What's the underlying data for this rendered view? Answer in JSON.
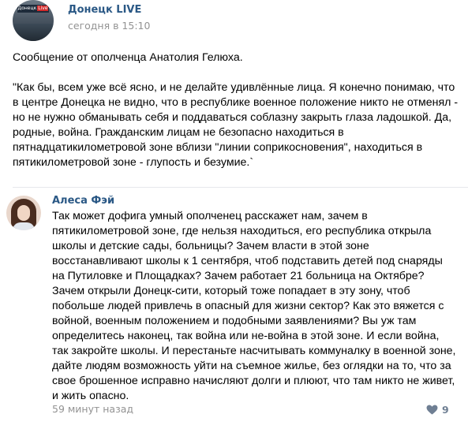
{
  "post": {
    "group_name": "Донецк LIVE",
    "avatar_logo_text": "Донецк",
    "avatar_logo_live": "Live",
    "time": "сегодня в 15:10",
    "intro": "Сообщение от ополченца Анатолия Гелюха.",
    "quote": "\"Как бы, всем уже всё ясно, и не делайте удивлённые лица. Я конечно понимаю, что в центре Донецка не видно, что в республике военное положение никто не отменял - но не нужно обманывать себя и поддаваться соблазну закрыть глаза ладошкой. Да, родные, война. Гражданским лицам не безопасно находиться в пятнадцатикилометровой зоне вблизи \"линии соприкосновения\", находиться в пятикилометровой зоне - глупость и безумие.`"
  },
  "comment": {
    "author": "Алеса Фэй",
    "text": "Так может дофига умный ополченец расскажет нам, зачем в пятикилометровой зоне, где нельзя находиться, его республика открыла школы и детские сады, больницы? Зачем власти в этой зоне восстанавливают школы к 1 сентября, чтоб подставить детей под снаряды на Путиловке и Площадках? Зачем работает 21 больница на Октябре? Зачем открыли Донецк-сити, который тоже попадает в эту зону, чтоб побольше людей привлечь в опасный для жизни сектор? Как это вяжется с войной, военным положением и подобными заявлениями? Вы уж там определитесь наконец, так война или не-война в этой зоне. И если война, так закройте школы. И перестаньте насчитывать коммуналку в военной зоне, дайте людям возможность уйти на съемное жилье, без оглядки на то, что за свое брошенное исправно начисляют долги и плюют, что там никто не живет, и жить опасно.",
    "time": "59 минут назад",
    "likes": "9",
    "like_icon": "heart-icon"
  },
  "colors": {
    "link": "#2a5885",
    "meta": "#939393",
    "like": "#6f7f93",
    "divider": "#e7e8ec"
  }
}
